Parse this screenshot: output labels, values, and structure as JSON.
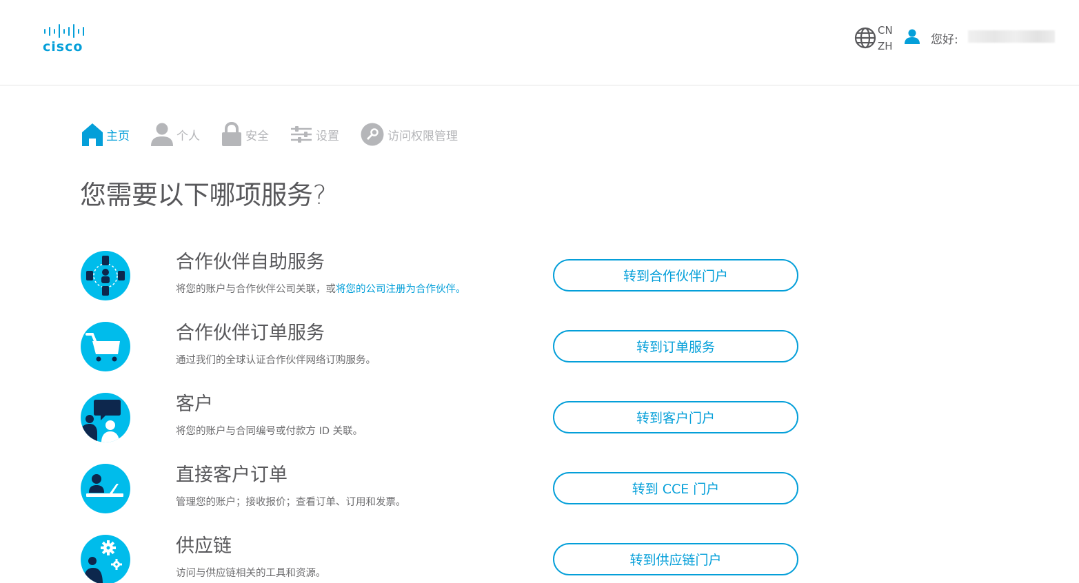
{
  "header": {
    "logo_text": "cisco",
    "lang_country": "CN",
    "lang_code": "ZH",
    "greeting": "您好:"
  },
  "nav": {
    "home": "主页",
    "profile": "个人",
    "security": "安全",
    "settings": "设置",
    "access": "访问权限管理"
  },
  "page_title": "您需要以下哪项服务?",
  "services": [
    {
      "title": "合作伙伴自助服务",
      "desc": "将您的账户与合作伙伴公司关联，或",
      "desc_link": "将您的公司注册为合作伙伴。",
      "button": "转到合作伙伴门户",
      "icon": "partner-network-icon"
    },
    {
      "title": "合作伙伴订单服务",
      "desc": "通过我们的全球认证合作伙伴网络订购服务。",
      "button": "转到订单服务",
      "icon": "shopping-cart-icon"
    },
    {
      "title": "客户",
      "desc": "将您的账户与合同编号或付款方 ID 关联。",
      "button": "转到客户门户",
      "icon": "customer-chat-icon"
    },
    {
      "title": "直接客户订单",
      "desc": "管理您的账户；接收报价；查看订单、订用和发票。",
      "button": "转到 CCE 门户",
      "icon": "laptop-user-icon"
    },
    {
      "title": "供应链",
      "desc": "访问与供应链相关的工具和资源。",
      "button": "转到供应链门户",
      "icon": "gears-user-icon"
    }
  ],
  "colors": {
    "brand": "#049fd9",
    "icon_bg": "#00bceb",
    "icon_dark": "#0d274d",
    "nav_inactive": "#b5b6b9",
    "text": "#58585b"
  }
}
